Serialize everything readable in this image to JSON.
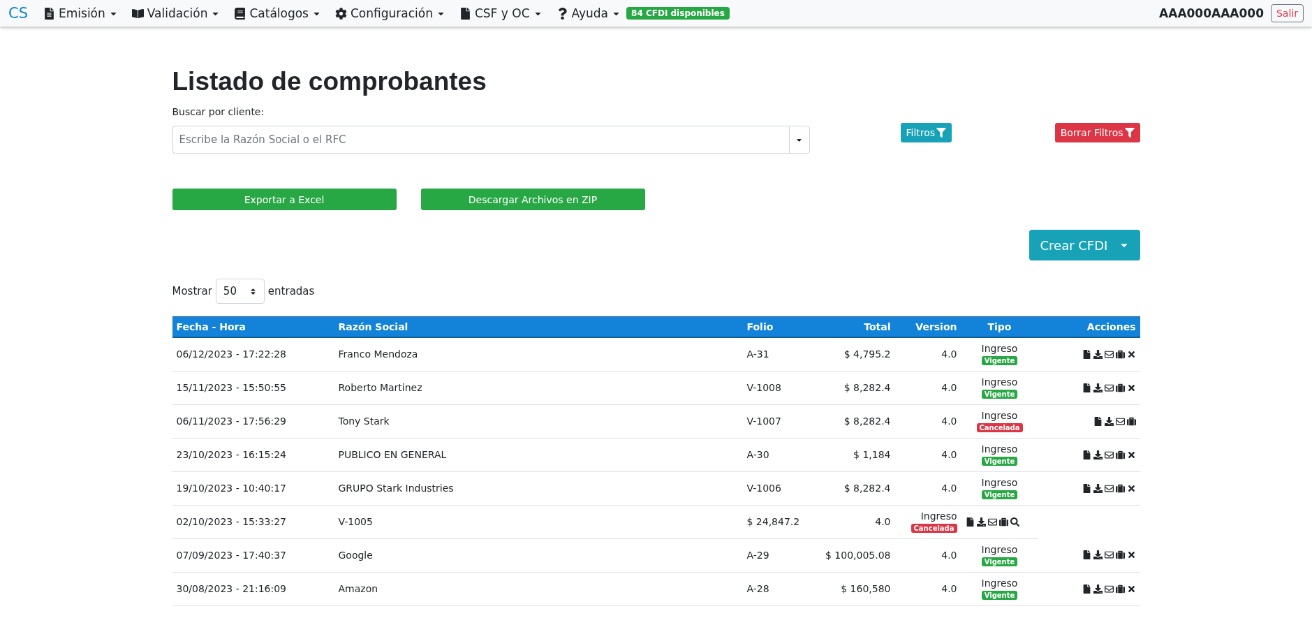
{
  "navbar": {
    "brand": "CS",
    "menus": [
      {
        "label": "Emisión"
      },
      {
        "label": "Validación"
      },
      {
        "label": "Catálogos"
      },
      {
        "label": "Configuración"
      },
      {
        "label": "CSF y OC"
      },
      {
        "label": "Ayuda"
      }
    ],
    "badge": "84 CFDI disponibles",
    "user": "AAA000AAA000",
    "logout": "Salir"
  },
  "title": "Listado de comprobantes",
  "search": {
    "label": "Buscar por cliente:",
    "placeholder": "Escribe la Razón Social o el RFC"
  },
  "filter_button": "Filtros",
  "clear_button": "Borrar Filtros",
  "export_buttons": [
    "Exportar a Excel",
    "Descargar Archivos en ZIP"
  ],
  "create_button": "Crear CFDI",
  "length": {
    "prefix": "Mostrar",
    "value": "50",
    "suffix": "entradas"
  },
  "table": {
    "columns": [
      "Fecha - Hora",
      "Razón Social",
      "Folio",
      "Total",
      "Version",
      "Tipo",
      "Acciones"
    ],
    "rows": [
      {
        "cells": [
          "06/12/2023 - 17:22:28",
          "Franco Mendoza",
          "A-31",
          "$ 4,795.2",
          "4.0"
        ],
        "tipo": "Ingreso",
        "status": {
          "label": "Vigente",
          "color": "#28a745"
        },
        "actions": [
          {
            "kind": "file"
          },
          {
            "kind": "download"
          },
          {
            "kind": "mail"
          },
          {
            "kind": "case"
          },
          {
            "kind": "close"
          }
        ]
      },
      {
        "cells": [
          "15/11/2023 - 15:50:55",
          "Roberto Martinez",
          "V-1008",
          "$ 8,282.4",
          "4.0"
        ],
        "tipo": "Ingreso",
        "status": {
          "label": "Vigente",
          "color": "#28a745"
        },
        "actions": [
          {
            "kind": "file"
          },
          {
            "kind": "download"
          },
          {
            "kind": "mail"
          },
          {
            "kind": "case"
          },
          {
            "kind": "close"
          }
        ]
      },
      {
        "cells": [
          "06/11/2023 - 17:56:29",
          "Tony Stark",
          "V-1007",
          "$ 8,282.4",
          "4.0"
        ],
        "tipo": "Ingreso",
        "status": {
          "label": "Cancelada",
          "color": "#dc3545"
        },
        "actions": [
          {
            "kind": "file"
          },
          {
            "kind": "download"
          },
          {
            "kind": "mail"
          },
          {
            "kind": "case"
          }
        ]
      },
      {
        "cells": [
          "23/10/2023 - 16:15:24",
          "PUBLICO EN GENERAL",
          "A-30",
          "$ 1,184",
          "4.0"
        ],
        "tipo": "Ingreso",
        "status": {
          "label": "Vigente",
          "color": "#28a745"
        },
        "actions": [
          {
            "kind": "file"
          },
          {
            "kind": "download"
          },
          {
            "kind": "mail"
          },
          {
            "kind": "case"
          },
          {
            "kind": "close"
          }
        ]
      },
      {
        "cells": [
          "19/10/2023 - 10:40:17",
          "GRUPO Stark Industries",
          "V-1006",
          "$ 8,282.4",
          "4.0"
        ],
        "tipo": "Ingreso",
        "status": {
          "label": "Vigente",
          "color": "#28a745"
        },
        "actions": [
          {
            "kind": "file"
          },
          {
            "kind": "download"
          },
          {
            "kind": "mail"
          },
          {
            "kind": "case"
          },
          {
            "kind": "close"
          }
        ]
      },
      {
        "cells": [
          "02/10/2023 - 15:33:27",
          "V-1005",
          "$ 24,847.2",
          "4.0"
        ],
        "tipo": "Ingreso",
        "status": {
          "label": "Cancelada",
          "color": "#dc3545"
        },
        "actions": [
          {
            "kind": "file"
          },
          {
            "kind": "download"
          },
          {
            "kind": "mail"
          },
          {
            "kind": "case"
          },
          {
            "kind": "search"
          }
        ]
      },
      {
        "cells": [
          "07/09/2023 - 17:40:37",
          "Google",
          "A-29",
          "$ 100,005.08",
          "4.0"
        ],
        "tipo": "Ingreso",
        "status": {
          "label": "Vigente",
          "color": "#28a745"
        },
        "actions": [
          {
            "kind": "file"
          },
          {
            "kind": "download"
          },
          {
            "kind": "mail"
          },
          {
            "kind": "case"
          },
          {
            "kind": "close"
          }
        ]
      },
      {
        "cells": [
          "30/08/2023 - 21:16:09",
          "Amazon",
          "A-28",
          "$ 160,580",
          "4.0"
        ],
        "tipo": "Ingreso",
        "status": {
          "label": "Vigente",
          "color": "#28a745"
        },
        "actions": [
          {
            "kind": "file"
          },
          {
            "kind": "download"
          },
          {
            "kind": "mail"
          },
          {
            "kind": "case"
          },
          {
            "kind": "close"
          }
        ]
      }
    ]
  }
}
